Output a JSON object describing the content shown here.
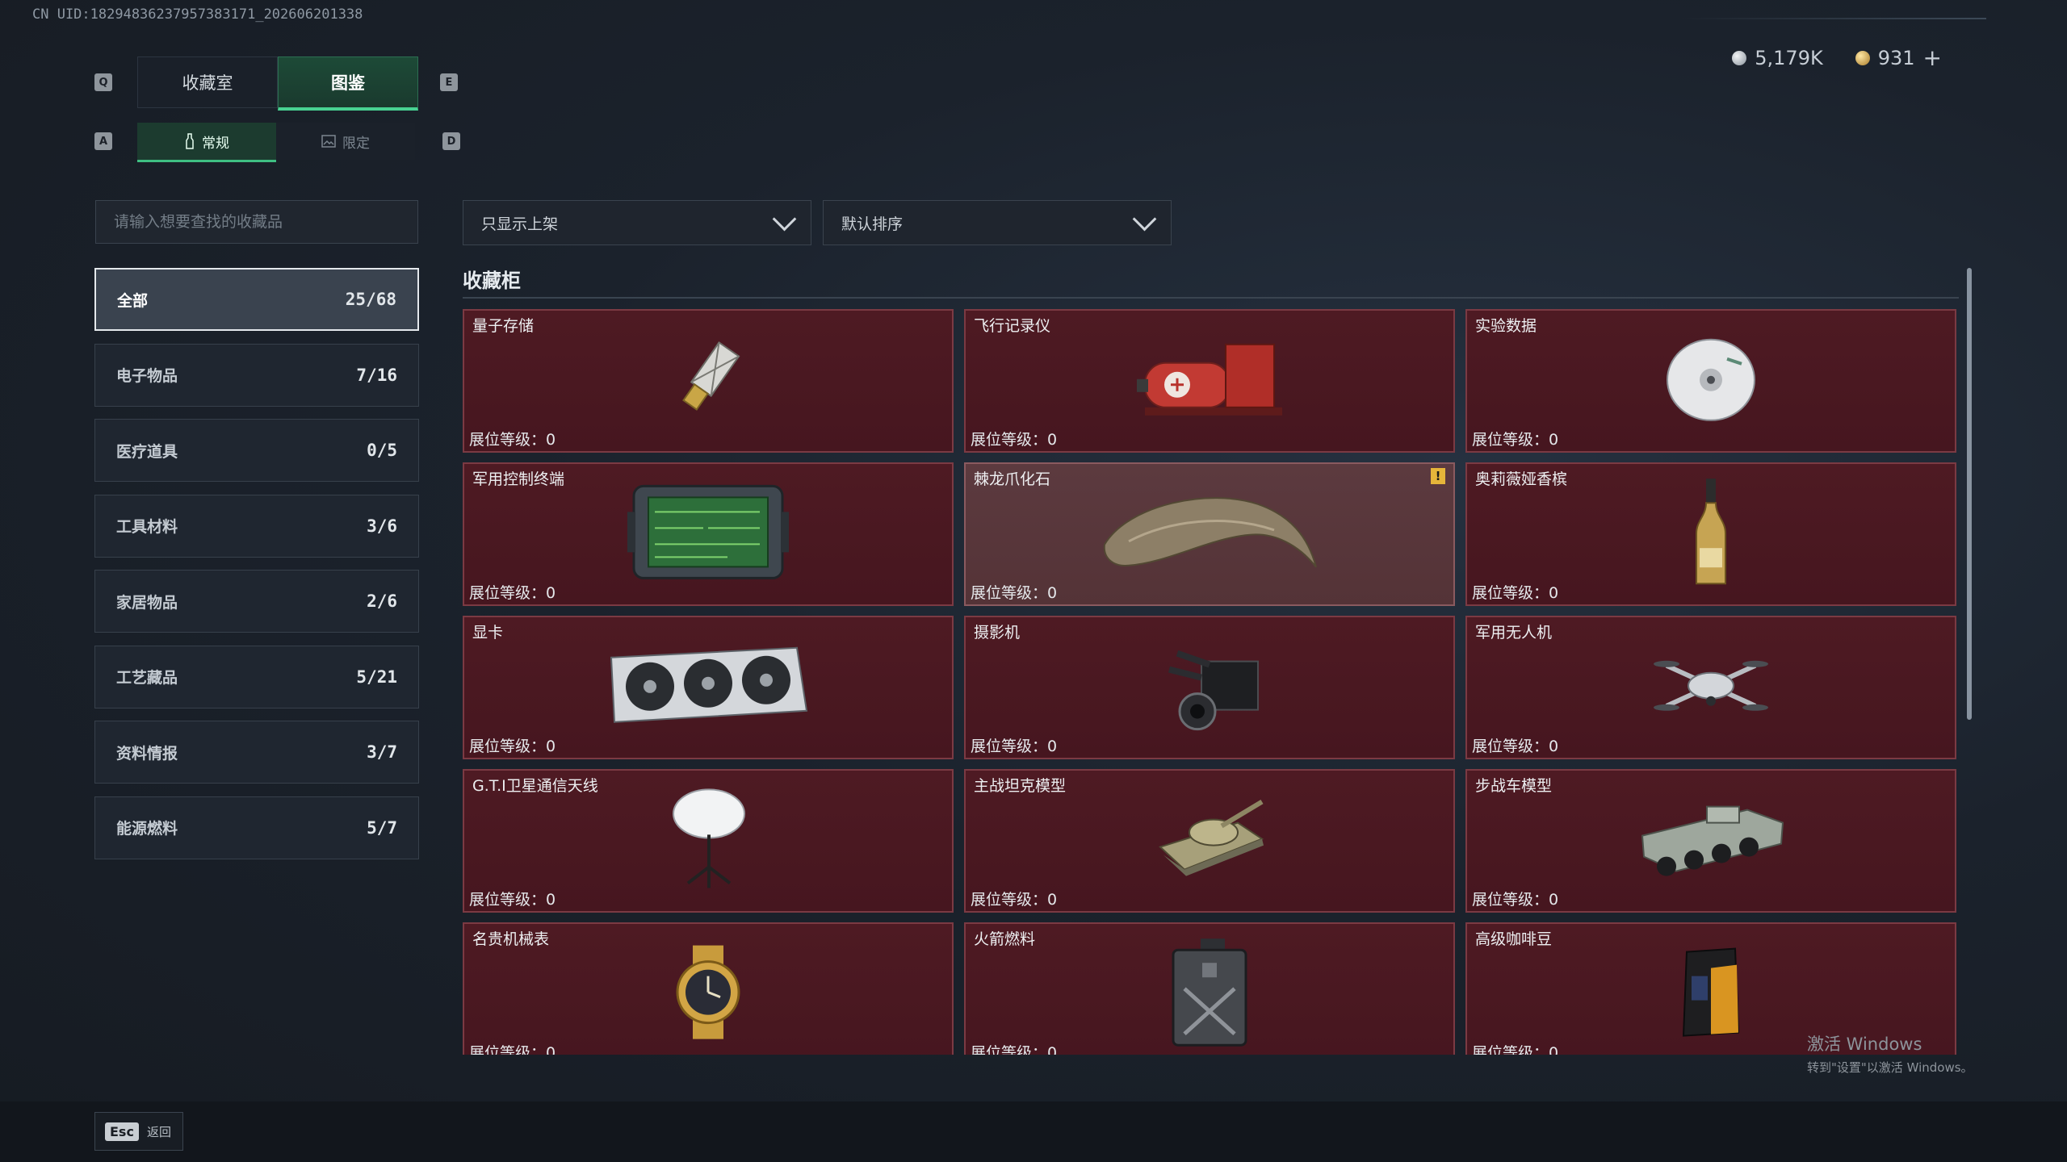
{
  "uid": "CN UID:18294836237957383171_202606201338",
  "currency": {
    "silver": "5,179K",
    "gold": "931",
    "plus": "+"
  },
  "keys": {
    "q": "Q",
    "e": "E",
    "a": "A",
    "d": "D"
  },
  "tabs": [
    {
      "label": "收藏室"
    },
    {
      "label": "图鉴"
    }
  ],
  "subtabs": [
    {
      "label": "常规"
    },
    {
      "label": "限定"
    }
  ],
  "search": {
    "placeholder": "请输入想要查找的收藏品"
  },
  "filter": {
    "value": "只显示上架"
  },
  "sort": {
    "value": "默认排序"
  },
  "categories": [
    {
      "label": "全部",
      "count": "25/68"
    },
    {
      "label": "电子物品",
      "count": "7/16"
    },
    {
      "label": "医疗道具",
      "count": "0/5"
    },
    {
      "label": "工具材料",
      "count": "3/6"
    },
    {
      "label": "家居物品",
      "count": "2/6"
    },
    {
      "label": "工艺藏品",
      "count": "5/21"
    },
    {
      "label": "资料情报",
      "count": "3/7"
    },
    {
      "label": "能源燃料",
      "count": "5/7"
    }
  ],
  "section": {
    "title": "收藏柜"
  },
  "level_label": "展位等级：0",
  "items": [
    {
      "name": "量子存储"
    },
    {
      "name": "飞行记录仪"
    },
    {
      "name": "实验数据"
    },
    {
      "name": "军用控制终端"
    },
    {
      "name": "棘龙爪化石",
      "warn": "!"
    },
    {
      "name": "奥莉薇娅香槟"
    },
    {
      "name": "显卡"
    },
    {
      "name": "摄影机"
    },
    {
      "name": "军用无人机"
    },
    {
      "name": "G.T.I卫星通信天线"
    },
    {
      "name": "主战坦克模型"
    },
    {
      "name": "步战车模型"
    },
    {
      "name": "名贵机械表"
    },
    {
      "name": "火箭燃料"
    },
    {
      "name": "高级咖啡豆"
    }
  ],
  "footer": {
    "esc_key": "Esc",
    "back": "返回"
  },
  "watermark": {
    "line1": "激活 Windows",
    "line2": "转到\"设置\"以激活 Windows。"
  }
}
